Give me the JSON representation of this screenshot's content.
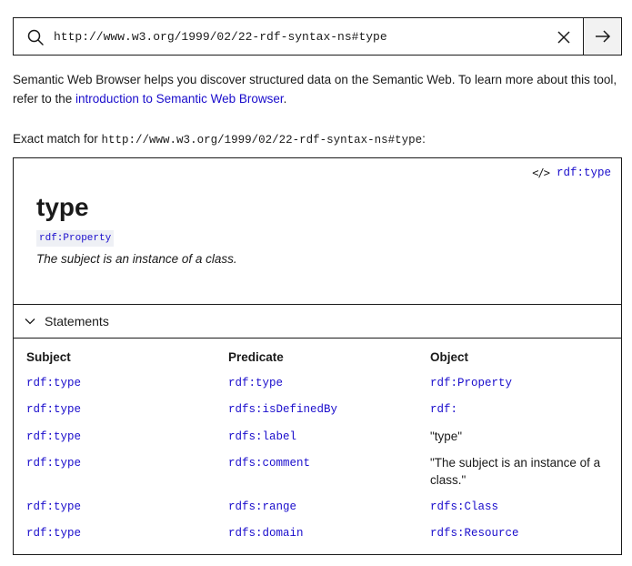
{
  "search": {
    "value": "http://www.w3.org/1999/02/22-rdf-syntax-ns#type",
    "icon": "search-icon",
    "clear_icon": "close-icon",
    "submit_icon": "arrow-right-icon"
  },
  "intro": {
    "text_before": "Semantic Web Browser helps you discover structured data on the Semantic Web. To learn more about this tool, refer to the ",
    "link_text": "introduction to Semantic Web Browser",
    "text_after": "."
  },
  "match": {
    "prefix": "Exact match for ",
    "uri": "http://www.w3.org/1999/02/22-rdf-syntax-ns#type",
    "suffix": ":"
  },
  "resource": {
    "source_icon": "code-icon",
    "source_link": "rdf:type",
    "title": "type",
    "type_badge": "rdf:Property",
    "description": "The subject is an instance of a class."
  },
  "statements": {
    "label": "Statements",
    "toggle_icon": "chevron-down-icon",
    "headers": [
      "Subject",
      "Predicate",
      "Object"
    ],
    "rows": [
      {
        "subject": "rdf:type",
        "predicate": "rdf:type",
        "object": "rdf:Property",
        "object_is_link": true
      },
      {
        "subject": "rdf:type",
        "predicate": "rdfs:isDefinedBy",
        "object": "rdf:",
        "object_is_link": true
      },
      {
        "subject": "rdf:type",
        "predicate": "rdfs:label",
        "object": "\"type\"",
        "object_is_link": false
      },
      {
        "subject": "rdf:type",
        "predicate": "rdfs:comment",
        "object": "\"The subject is an instance of a class.\"",
        "object_is_link": false
      },
      {
        "subject": "rdf:type",
        "predicate": "rdfs:range",
        "object": "rdfs:Class",
        "object_is_link": true
      },
      {
        "subject": "rdf:type",
        "predicate": "rdfs:domain",
        "object": "rdfs:Resource",
        "object_is_link": true
      }
    ]
  },
  "colors": {
    "link": "#1a0dcc",
    "text": "#1a1a1a",
    "badge_bg": "#eef0f5",
    "button_bg": "#f2f2f2"
  }
}
